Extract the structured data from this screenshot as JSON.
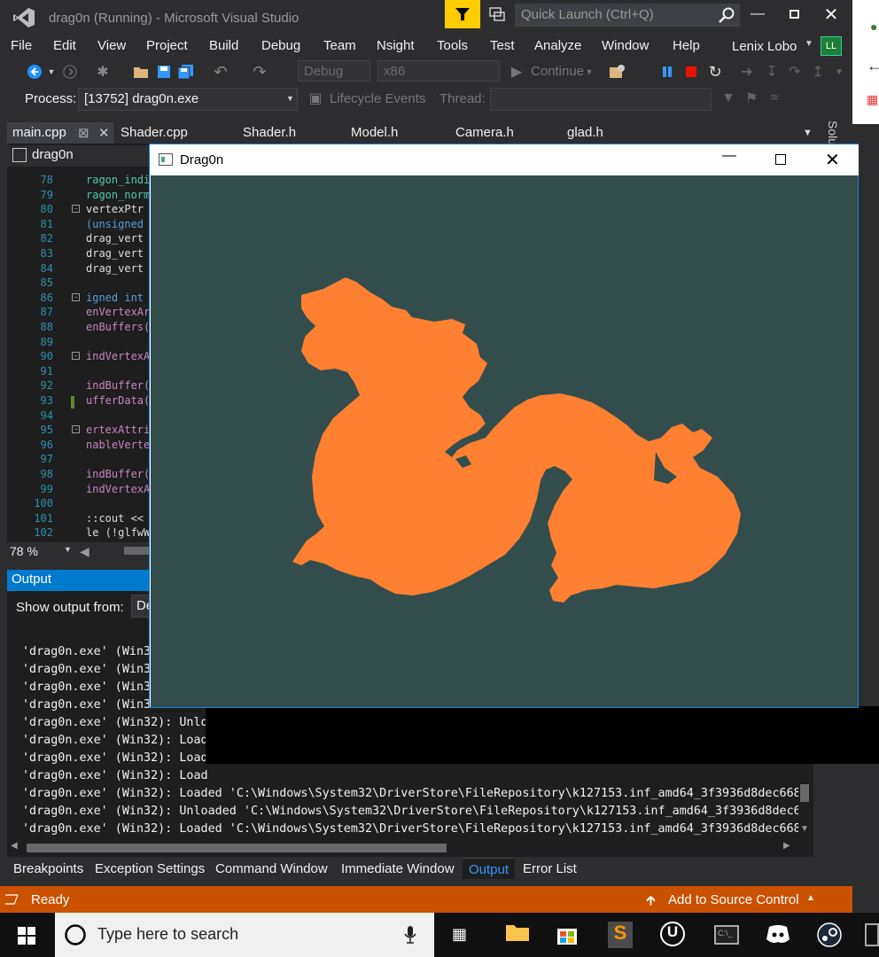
{
  "titlebar": {
    "title": "drag0n (Running) - Microsoft Visual Studio",
    "quick_launch_placeholder": "Quick Launch (Ctrl+Q)"
  },
  "menu": [
    "File",
    "Edit",
    "View",
    "Project",
    "Build",
    "Debug",
    "Team",
    "Nsight",
    "Tools",
    "Test",
    "Analyze",
    "Window",
    "Help"
  ],
  "user": {
    "name": "Lenix Lobo",
    "initials": "LL"
  },
  "toolbar": {
    "config": "Debug",
    "platform": "x86",
    "continue_label": "Continue"
  },
  "debug_toolbar": {
    "process_label": "Process:",
    "process_value": "[13752] drag0n.exe",
    "lifecycle_label": "Lifecycle Events",
    "thread_label": "Thread:"
  },
  "tabs": [
    "main.cpp",
    "Shader.cpp",
    "Shader.h",
    "Model.h",
    "Camera.h",
    "glad.h"
  ],
  "solution_explorer_label": "Solu",
  "editor": {
    "nav_combo": "drag0n",
    "lines": [
      {
        "n": "78",
        "t": "ragon_indi",
        "c": "#4ec9b0"
      },
      {
        "n": "79",
        "t": "ragon_norm",
        "c": "#4ec9b0"
      },
      {
        "n": "80",
        "t": " vertexPtr",
        "c": "#dcdcdc"
      },
      {
        "n": "81",
        "t": " (unsigned",
        "c": "#569cd6"
      },
      {
        "n": "82",
        "t": " drag_vert",
        "c": "#dcdcdc"
      },
      {
        "n": "83",
        "t": " drag_vert",
        "c": "#dcdcdc"
      },
      {
        "n": "84",
        "t": " drag_vert",
        "c": "#dcdcdc"
      },
      {
        "n": "85",
        "t": "",
        "c": "#dcdcdc"
      },
      {
        "n": "86",
        "t": "igned int ",
        "c": "#569cd6"
      },
      {
        "n": "87",
        "t": "enVertexAr",
        "c": "#c586c0"
      },
      {
        "n": "88",
        "t": "enBuffers(",
        "c": "#c586c0"
      },
      {
        "n": "89",
        "t": "",
        "c": "#dcdcdc"
      },
      {
        "n": "90",
        "t": "indVertexA",
        "c": "#c586c0"
      },
      {
        "n": "91",
        "t": "",
        "c": "#dcdcdc"
      },
      {
        "n": "92",
        "t": "indBuffer(",
        "c": "#c586c0"
      },
      {
        "n": "93",
        "t": "ufferData(",
        "c": "#c586c0"
      },
      {
        "n": "94",
        "t": "",
        "c": "#dcdcdc"
      },
      {
        "n": "95",
        "t": "ertexAttri",
        "c": "#c586c0"
      },
      {
        "n": "96",
        "t": "nableVerte",
        "c": "#c586c0"
      },
      {
        "n": "97",
        "t": "",
        "c": "#dcdcdc"
      },
      {
        "n": "98",
        "t": "indBuffer(",
        "c": "#c586c0"
      },
      {
        "n": "99",
        "t": "indVertexA",
        "c": "#c586c0"
      },
      {
        "n": "100",
        "t": "",
        "c": "#dcdcdc"
      },
      {
        "n": "101",
        "t": "::cout << ",
        "c": "#dcdcdc"
      },
      {
        "n": "102",
        "t": "le (!glfwW",
        "c": "#dcdcdc"
      }
    ],
    "zoom": "78 %"
  },
  "output": {
    "header": "Output",
    "show_from_label": "Show output from:",
    "show_from_value": "De",
    "lines": [
      "'drag0n.exe' (Win32",
      "'drag0n.exe' (Win32",
      "'drag0n.exe' (Win32",
      "'drag0n.exe' (Win32",
      "'drag0n.exe' (Win32): Unlo",
      "'drag0n.exe' (Win32): Load",
      "'drag0n.exe' (Win32): Load",
      "'drag0n.exe' (Win32): Load",
      "'drag0n.exe' (Win32): Loaded 'C:\\Windows\\System32\\DriverStore\\FileRepository\\k127153.inf_amd64_3f3936d8dec668b",
      "'drag0n.exe' (Win32): Unloaded 'C:\\Windows\\System32\\DriverStore\\FileRepository\\k127153.inf_amd64_3f3936d8dec66",
      "'drag0n.exe' (Win32): Loaded 'C:\\Windows\\System32\\DriverStore\\FileRepository\\k127153.inf_amd64_3f3936d8dec668b"
    ]
  },
  "bottom_tabs": [
    "Breakpoints",
    "Exception Settings",
    "Command Window",
    "Immediate Window",
    "Output",
    "Error List"
  ],
  "status": {
    "text": "Ready",
    "source_control": "Add to Source Control"
  },
  "taskbar": {
    "search_placeholder": "Type here to search"
  },
  "app_window": {
    "title": "Drag0n",
    "background": "#334d4d",
    "model_color": "#ff8030"
  },
  "colors": {
    "accent": "#007acc",
    "status_bar": "#ca5100",
    "filter_btn": "#ffcc00"
  }
}
